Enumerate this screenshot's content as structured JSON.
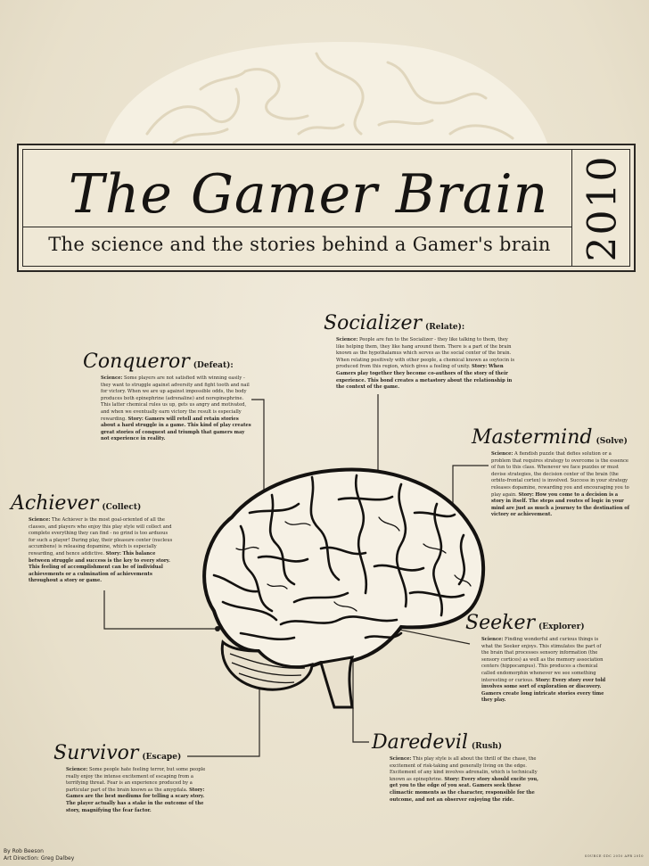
{
  "header": {
    "title": "The Gamer Brain",
    "subtitle": "The science and the stories behind a Gamer's brain",
    "year": "2010"
  },
  "types": {
    "socializer": {
      "name": "Socializer",
      "verb": "(Relate):",
      "science_label": "Science:",
      "science": "People are fun to the Socializer - they like talking to them, they like helping them, they like hang around them. There is a part of the brain known as the hypothalamus which serves as the social center of the brain. When relating positively with other people, a chemical known as oxytocin is produced from this region, which gives a feeling of unity.",
      "story_label": "Story:",
      "story": "When Gamers play together they become co-authors of the story of their experience. This bond creates a metastory about the relationship in the context of the game."
    },
    "conqueror": {
      "name": "Conqueror",
      "verb": "(Defeat):",
      "science_label": "Science:",
      "science": "Some players are not satisfied with winning easily - they want to struggle against adversity and fight tooth and nail for victory. When we are up against impossible odds, the body produces both epinephrine (adrenaline) and norepinephrine. This latter chemical rules us up, gets us angry and motivated, and when we eventually earn victory the result is especially rewarding.",
      "story_label": "Story:",
      "story": "Gamers will retell and retain stories about a hard struggle in a game. This kind of play creates great stories of conquest and triumph that gamers may not experience in reality."
    },
    "mastermind": {
      "name": "Mastermind",
      "verb": "(Solve)",
      "science_label": "Science:",
      "science": "A fiendish puzzle that defies solution or a problem that requires strategy to overcome is the essence of fun to this class. Whenever we face puzzles or must devise strategies, the decision center of the brain (the orbito-frontal cortex) is involved. Success in your strategy releases dopamine, rewarding you and encouraging you to play again.",
      "story_label": "Story:",
      "story": "How you come to a decision is a story in itself. The steps and routes of logic in your mind are just as much a journey to the destination of victory or achievement."
    },
    "achiever": {
      "name": "Achiever",
      "verb": "(Collect)",
      "science_label": "Science:",
      "science": "The Achiever is the most goal-oriented of all the classes, and players who enjoy this play style will collect and complete everything they can find - no grind is too arduous for such a player! During play, their pleasure center (nucleus accumbens) is releasing dopamine, which is especially rewarding, and hence addictive.",
      "story_label": "Story:",
      "story": "This balance between struggle and success is the key to every story. This feeling of accomplishment can be of individual achievements or a culmination of achievements throughout a story or game."
    },
    "seeker": {
      "name": "Seeker",
      "verb": "(Explorer)",
      "science_label": "Science:",
      "science": "Finding wonderful and curious things is what the Seeker enjoys. This stimulates the part of the brain that processes sensory information (the sensory cortices) as well as the memory association centers (hippocampus). This produces a chemical called endomorphin whenever we see something interesting or curious.",
      "story_label": "Story:",
      "story": "Every story ever told involves some sort of exploration or discovery. Gamers create long intricate stories every time they play."
    },
    "survivor": {
      "name": "Survivor",
      "verb": "(Escape)",
      "science_label": "Science:",
      "science": "Some people hate feeling terror, but some people really enjoy the intense excitement of escaping from a terrifying threat. Fear is an experience produced by a particular part of the brain known as the amygdala.",
      "story_label": "Story:",
      "story": "Games are the best mediums for telling a scary story. The player actually has a stake in the outcome of the story, magnifying the fear factor."
    },
    "daredevil": {
      "name": "Daredevil",
      "verb": "(Rush)",
      "science_label": "Science:",
      "science": "This play style is all about the thrill of the chase, the excitement of risk-taking and generally living on the edge. Excitement of any kind involves adrenalin, which is technically known as epinephrine.",
      "story_label": "Story:",
      "story": "Every story should excite you, get you to the edge of you seat. Gamers seek these climactic moments as the character, responsible for the outcome, and not an observer enjoying the ride."
    }
  },
  "credits": {
    "author": "By Rob Beeson",
    "art": "Art Direction: Greg Dalbey"
  },
  "source": "SOURCE GDC 2010 APR 2010"
}
